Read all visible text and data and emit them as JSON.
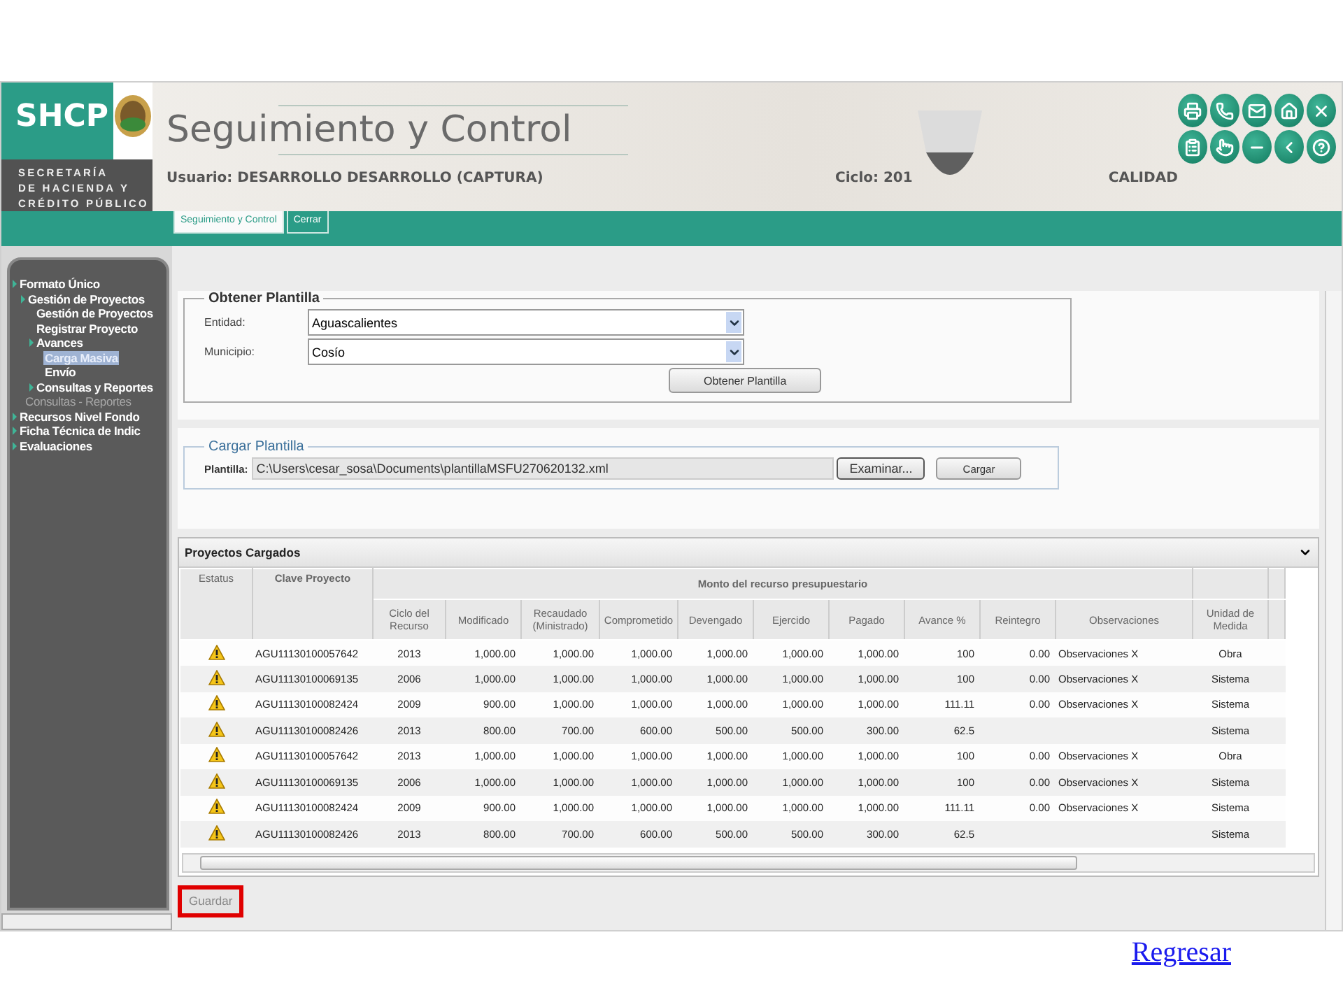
{
  "header": {
    "logo": "SHCP",
    "agency_lines": [
      "SECRETARÍA",
      "DE HACIENDA Y",
      "CRÉDITO PÚBLICO"
    ],
    "title": "Seguimiento y Control",
    "user": "Usuario: DESARROLLO DESARROLLO (CAPTURA)",
    "cycle": "Ciclo: 201",
    "environment": "CALIDAD"
  },
  "tabs": [
    {
      "label": "Seguimiento y Control",
      "selected": true
    },
    {
      "label": "Cerrar",
      "selected": false
    }
  ],
  "sidebar": {
    "items": [
      {
        "label": "Formato Único",
        "kind": "folder",
        "selected": false,
        "children": [
          {
            "label": "Gestión de Proyectos",
            "kind": "folder",
            "selected": false,
            "children": [
              {
                "label": "Gestión de Proyectos",
                "kind": "page",
                "selected": false
              },
              {
                "label": "Registrar Proyecto",
                "kind": "page",
                "selected": false
              },
              {
                "label": "Avances",
                "kind": "folder",
                "selected": false,
                "children": [
                  {
                    "label": "Carga Masiva",
                    "kind": "page",
                    "selected": true
                  },
                  {
                    "label": "Envío",
                    "kind": "page",
                    "selected": false
                  }
                ]
              },
              {
                "label": "Consultas y Reportes",
                "kind": "folder",
                "selected": false
              }
            ]
          }
        ]
      },
      {
        "label": "Consultas - Reportes",
        "kind": "sublink",
        "selected": false
      },
      {
        "label": "Recursos Nivel Fondo",
        "kind": "folder",
        "selected": false
      },
      {
        "label": "Ficha Técnica de Indic",
        "kind": "folder",
        "selected": false
      },
      {
        "label": "Evaluaciones",
        "kind": "folder",
        "selected": false
      }
    ]
  },
  "obtener_plantilla": {
    "title": "Obtener Plantilla",
    "fields": [
      {
        "label": "Entidad:",
        "value": "Aguascalientes"
      },
      {
        "label": "Municipio:",
        "value": "Cosío"
      }
    ],
    "button": "Obtener Plantilla"
  },
  "cargar_plantilla": {
    "title": "Cargar Plantilla",
    "label": "Plantilla:",
    "value": "C:\\Users\\cesar_sosa\\Documents\\plantillaMSFU270620132.xml",
    "browse_button": "Examinar...",
    "upload_button": "Cargar"
  },
  "table": {
    "title": "Proyectos Cargados",
    "group_header": "Monto del recurso presupuestario",
    "columns": [
      "Estatus",
      "Clave Proyecto",
      "Ciclo del Recurso",
      "Modificado",
      "Recaudado (Ministrado)",
      "Comprometido",
      "Devengado",
      "Ejercido",
      "Pagado",
      "Avance %",
      "Reintegro",
      "Observaciones",
      "Unidad de Medida"
    ],
    "rows": [
      {
        "cells": [
          "",
          "AGU11130100057642",
          "2013",
          "1,000.00",
          "1,000.00",
          "1,000.00",
          "1,000.00",
          "1,000.00",
          "1,000.00",
          "100",
          "0.00",
          "Observaciones X",
          "Obra"
        ]
      },
      {
        "cells": [
          "",
          "AGU11130100069135",
          "2006",
          "1,000.00",
          "1,000.00",
          "1,000.00",
          "1,000.00",
          "1,000.00",
          "1,000.00",
          "100",
          "0.00",
          "Observaciones X",
          "Sistema"
        ]
      },
      {
        "cells": [
          "",
          "AGU11130100082424",
          "2009",
          "900.00",
          "1,000.00",
          "1,000.00",
          "1,000.00",
          "1,000.00",
          "1,000.00",
          "111.11",
          "0.00",
          "Observaciones X",
          "Sistema"
        ]
      },
      {
        "cells": [
          "",
          "AGU11130100082426",
          "2013",
          "800.00",
          "700.00",
          "600.00",
          "500.00",
          "500.00",
          "300.00",
          "62.5",
          "",
          "",
          "Sistema"
        ]
      },
      {
        "cells": [
          "",
          "AGU11130100057642",
          "2013",
          "1,000.00",
          "1,000.00",
          "1,000.00",
          "1,000.00",
          "1,000.00",
          "1,000.00",
          "100",
          "0.00",
          "Observaciones X",
          "Obra"
        ]
      },
      {
        "cells": [
          "",
          "AGU11130100069135",
          "2006",
          "1,000.00",
          "1,000.00",
          "1,000.00",
          "1,000.00",
          "1,000.00",
          "1,000.00",
          "100",
          "0.00",
          "Observaciones X",
          "Sistema"
        ]
      },
      {
        "cells": [
          "",
          "AGU11130100082424",
          "2009",
          "900.00",
          "1,000.00",
          "1,000.00",
          "1,000.00",
          "1,000.00",
          "1,000.00",
          "111.11",
          "0.00",
          "Observaciones X",
          "Sistema"
        ]
      },
      {
        "cells": [
          "",
          "AGU11130100082426",
          "2013",
          "800.00",
          "700.00",
          "600.00",
          "500.00",
          "500.00",
          "300.00",
          "62.5",
          "",
          "",
          "Sistema"
        ]
      }
    ]
  },
  "save_button": {
    "label": "Guardar",
    "highlighted": true
  },
  "back_link": "Regresar"
}
